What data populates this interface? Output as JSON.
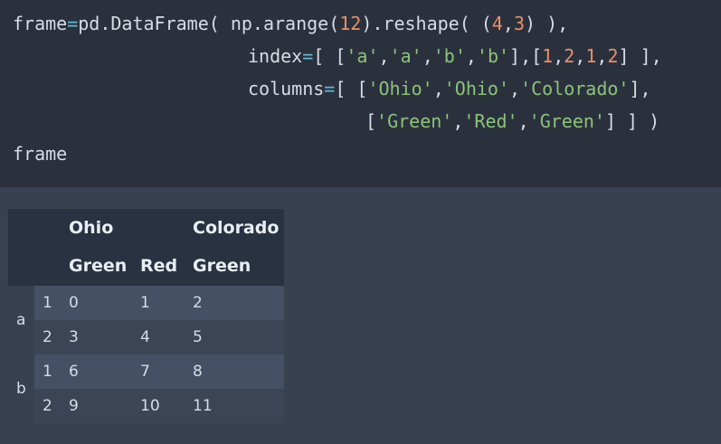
{
  "code": {
    "lines": [
      [
        [
          "frame",
          "t"
        ],
        [
          "=",
          "op"
        ],
        [
          "pd.DataFrame( np.arange(",
          "t"
        ],
        [
          "12",
          "num"
        ],
        [
          ").reshape( (",
          "t"
        ],
        [
          "4",
          "num"
        ],
        [
          ",",
          "t"
        ],
        [
          "3",
          "num"
        ],
        [
          ") ),",
          "t"
        ]
      ],
      [
        [
          "index",
          "t"
        ],
        [
          "=",
          "op"
        ],
        [
          "[ [",
          "t"
        ],
        [
          "'a'",
          "str"
        ],
        [
          ",",
          "t"
        ],
        [
          "'a'",
          "str"
        ],
        [
          ",",
          "t"
        ],
        [
          "'b'",
          "str"
        ],
        [
          ",",
          "t"
        ],
        [
          "'b'",
          "str"
        ],
        [
          "],[",
          "t"
        ],
        [
          "1",
          "num"
        ],
        [
          ",",
          "t"
        ],
        [
          "2",
          "num"
        ],
        [
          ",",
          "t"
        ],
        [
          "1",
          "num"
        ],
        [
          ",",
          "t"
        ],
        [
          "2",
          "num"
        ],
        [
          "] ],",
          "t"
        ]
      ],
      [
        [
          "columns",
          "t"
        ],
        [
          "=",
          "op"
        ],
        [
          "[ [",
          "t"
        ],
        [
          "'Ohio'",
          "str"
        ],
        [
          ",",
          "t"
        ],
        [
          "'Ohio'",
          "str"
        ],
        [
          ",",
          "t"
        ],
        [
          "'Colorado'",
          "str"
        ],
        [
          "],",
          "t"
        ]
      ],
      [
        [
          "[",
          "t"
        ],
        [
          "'Green'",
          "str"
        ],
        [
          ",",
          "t"
        ],
        [
          "'Red'",
          "str"
        ],
        [
          ",",
          "t"
        ],
        [
          "'Green'",
          "str"
        ],
        [
          "] ] )",
          "t"
        ]
      ],
      [
        [
          "frame",
          "t"
        ]
      ]
    ]
  },
  "table": {
    "header_level0": [
      "Ohio",
      "Colorado"
    ],
    "header_level1": [
      "Green",
      "Red",
      "Green"
    ],
    "index_level0": [
      "a",
      "b"
    ],
    "rows": [
      {
        "idx": "1",
        "values": [
          "0",
          "1",
          "2"
        ]
      },
      {
        "idx": "2",
        "values": [
          "3",
          "4",
          "5"
        ]
      },
      {
        "idx": "1",
        "values": [
          "6",
          "7",
          "8"
        ]
      },
      {
        "idx": "2",
        "values": [
          "9",
          "10",
          "11"
        ]
      }
    ]
  },
  "colors": {
    "code_bg": "#2b313c",
    "output_bg": "#374150",
    "table_header_bg": "#283240",
    "row_odd": "#455065",
    "row_even": "#3b4556",
    "operator": "#5fb8d9",
    "number": "#e8906a",
    "string": "#8ac47a"
  }
}
